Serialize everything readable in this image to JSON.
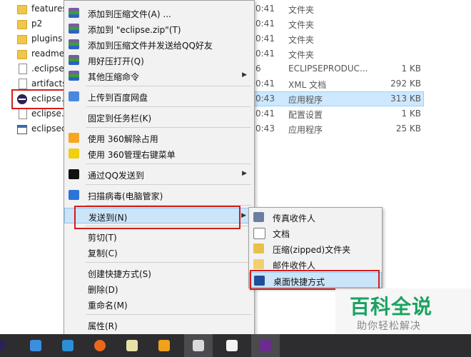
{
  "files": [
    {
      "name": "features",
      "date": "0:41",
      "type": "文件夹",
      "size": "",
      "icon": "folder-icon"
    },
    {
      "name": "p2",
      "date": "0:41",
      "type": "文件夹",
      "size": "",
      "icon": "folder-icon"
    },
    {
      "name": "plugins",
      "date": "0:41",
      "type": "文件夹",
      "size": "",
      "icon": "folder-icon"
    },
    {
      "name": "readme",
      "date": "0:41",
      "type": "文件夹",
      "size": "",
      "icon": "folder-icon"
    },
    {
      "name": ".eclipse",
      "date": "6",
      "type": "ECLIPSEPRODUC...",
      "size": "1 KB",
      "icon": "doc-icon"
    },
    {
      "name": "artifacts",
      "date": "0:41",
      "type": "XML 文档",
      "size": "292 KB",
      "icon": "doc-icon"
    },
    {
      "name": "eclipse.",
      "date": "0:43",
      "type": "应用程序",
      "size": "313 KB",
      "icon": "eclipse-icon"
    },
    {
      "name": "eclipse.",
      "date": "0:41",
      "type": "配置设置",
      "size": "1 KB",
      "icon": "doc-icon"
    },
    {
      "name": "eclipsec",
      "date": "0:43",
      "type": "应用程序",
      "size": "25 KB",
      "icon": "app-icon"
    }
  ],
  "context_menu": [
    {
      "label": "添加到压缩文件(A) ...",
      "icon": "winrar-icon"
    },
    {
      "label": "添加到 \"eclipse.zip\"(T)",
      "icon": "winrar-icon"
    },
    {
      "label": "添加到压缩文件并发送给QQ好友",
      "icon": "winrar-icon"
    },
    {
      "label": "用好压打开(Q)",
      "icon": "winrar-icon"
    },
    {
      "label": "其他压缩命令",
      "icon": "winrar-icon",
      "arrow": "▶"
    },
    {
      "label": "上传到百度网盘",
      "icon": "baidu-netdisk-icon"
    },
    {
      "label": "固定到任务栏(K)"
    },
    {
      "label": "使用 360解除占用",
      "icon": "360-unlock-icon"
    },
    {
      "label": "使用 360管理右键菜单",
      "icon": "360-menu-icon"
    },
    {
      "label": "通过QQ发送到",
      "icon": "qq-icon",
      "arrow": "▶"
    },
    {
      "label": "扫描病毒(电脑管家)",
      "icon": "tencent-guard-icon"
    },
    {
      "label": "发送到(N)",
      "arrow": "▶"
    },
    {
      "label": "剪切(T)"
    },
    {
      "label": "复制(C)"
    },
    {
      "label": "创建快捷方式(S)"
    },
    {
      "label": "删除(D)"
    },
    {
      "label": "重命名(M)"
    },
    {
      "label": "属性(R)"
    }
  ],
  "send_to_menu": [
    {
      "label": "传真收件人",
      "icon": "fax-icon"
    },
    {
      "label": "文档",
      "icon": "document-icon"
    },
    {
      "label": "压缩(zipped)文件夹",
      "icon": "zip-folder-icon"
    },
    {
      "label": "邮件收件人",
      "icon": "mail-icon"
    },
    {
      "label": "桌面快捷方式",
      "icon": "desktop-icon"
    }
  ],
  "watermark": {
    "title": "百科全说",
    "subtitle": "助你轻松解决"
  },
  "colors": {
    "highlight": "#cce4f7",
    "red_box": "#d21d1d",
    "taskbar": "#2d2d30",
    "watermark_green": "#1aa260"
  }
}
